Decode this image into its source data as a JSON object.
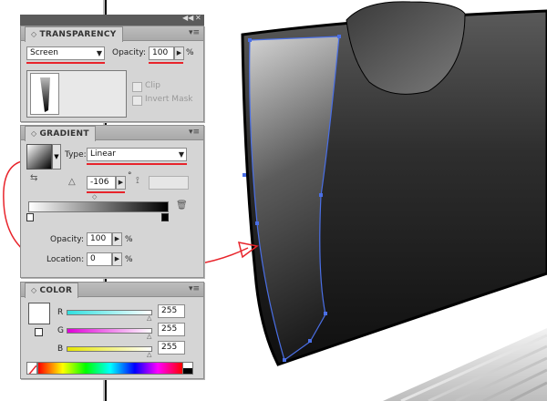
{
  "dock": {
    "collapse_label": "◀◀",
    "close_label": "✕"
  },
  "transparency": {
    "title": "TRANSPARENCY",
    "blend_mode": "Screen",
    "opacity_label": "Opacity:",
    "opacity_value": "100",
    "opacity_unit": "%",
    "clip_label": "Clip",
    "invert_mask_label": "Invert Mask"
  },
  "gradient": {
    "title": "GRADIENT",
    "type_label": "Type:",
    "type_value": "Linear",
    "angle_value": "-106",
    "angle_unit": "°",
    "opacity_label": "Opacity:",
    "opacity_value": "100",
    "opacity_unit": "%",
    "location_label": "Location:",
    "location_value": "0",
    "location_unit": "%"
  },
  "color": {
    "title": "COLOR",
    "channels": [
      {
        "label": "R",
        "value": "255",
        "color": "#2fe0e0"
      },
      {
        "label": "G",
        "value": "255",
        "color": "#e000d8"
      },
      {
        "label": "B",
        "value": "255",
        "color": "#e6e600"
      }
    ]
  },
  "colors": {
    "annotation_red": "#e8242b",
    "path_blue": "#4a6fe6",
    "panel_gray": "#d5d5d5"
  }
}
